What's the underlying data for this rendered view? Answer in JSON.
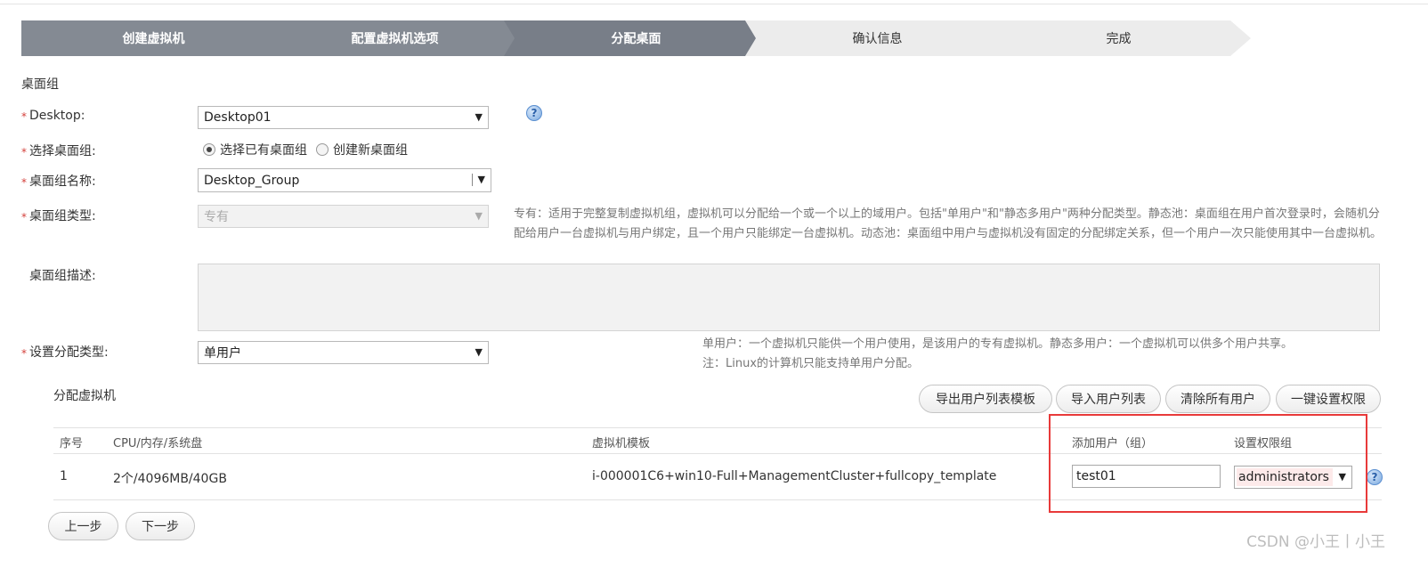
{
  "wizard": {
    "steps": [
      {
        "label": "创建虚拟机",
        "state": "done"
      },
      {
        "label": "配置虚拟机选项",
        "state": "done"
      },
      {
        "label": "分配桌面",
        "state": "active"
      },
      {
        "label": "确认信息",
        "state": "todo"
      },
      {
        "label": "完成",
        "state": "todo"
      }
    ]
  },
  "section": {
    "title": "桌面组"
  },
  "form": {
    "required_mark": "*",
    "desktop": {
      "label": "Desktop:",
      "value": "Desktop01"
    },
    "select_group": {
      "label": "选择桌面组:",
      "options": [
        {
          "label": "选择已有桌面组",
          "checked": true
        },
        {
          "label": "创建新桌面组",
          "checked": false
        }
      ]
    },
    "group_name": {
      "label": "桌面组名称:",
      "value": "Desktop_Group"
    },
    "group_type": {
      "label": "桌面组类型:",
      "value": "专有",
      "description": "专有：适用于完整复制虚拟机组，虚拟机可以分配给一个或一个以上的域用户。包括\"单用户\"和\"静态多用户\"两种分配类型。静态池：桌面组在用户首次登录时，会随机分配给用户一台虚拟机与用户绑定，且一个用户只能绑定一台虚拟机。动态池：桌面组中用户与虚拟机没有固定的分配绑定关系，但一个用户一次只能使用其中一台虚拟机。"
    },
    "group_desc": {
      "label": "桌面组描述:",
      "value": ""
    },
    "assign_type": {
      "label": "设置分配类型:",
      "value": "单用户",
      "description_line1": "单用户：一个虚拟机只能供一个用户使用，是该用户的专有虚拟机。静态多用户：一个虚拟机可以供多个用户共享。",
      "description_line2": "注：Linux的计算机只能支持单用户分配。"
    }
  },
  "assign": {
    "title": "分配虚拟机",
    "buttons": {
      "export_template": "导出用户列表模板",
      "import_users": "导入用户列表",
      "clear_users": "清除所有用户",
      "set_permissions": "一键设置权限"
    },
    "columns": [
      "序号",
      "CPU/内存/系统盘",
      "虚拟机模板",
      "添加用户（组）",
      "设置权限组"
    ],
    "rows": [
      {
        "index": "1",
        "spec": "2个/4096MB/40GB",
        "template": "i-000001C6+win10-Full+ManagementCluster+fullcopy_template",
        "user": "test01",
        "permission": "administrators"
      }
    ]
  },
  "nav": {
    "prev": "上一步",
    "next": "下一步"
  },
  "watermark": "CSDN @小王丨小王",
  "colors": {
    "step_done": "#848a93",
    "step_todo": "#ececec",
    "required": "#d43f3a",
    "highlight_border": "#e83a3a"
  },
  "icons": {
    "help": "help-icon",
    "dropdown": "chevron-down-icon"
  }
}
